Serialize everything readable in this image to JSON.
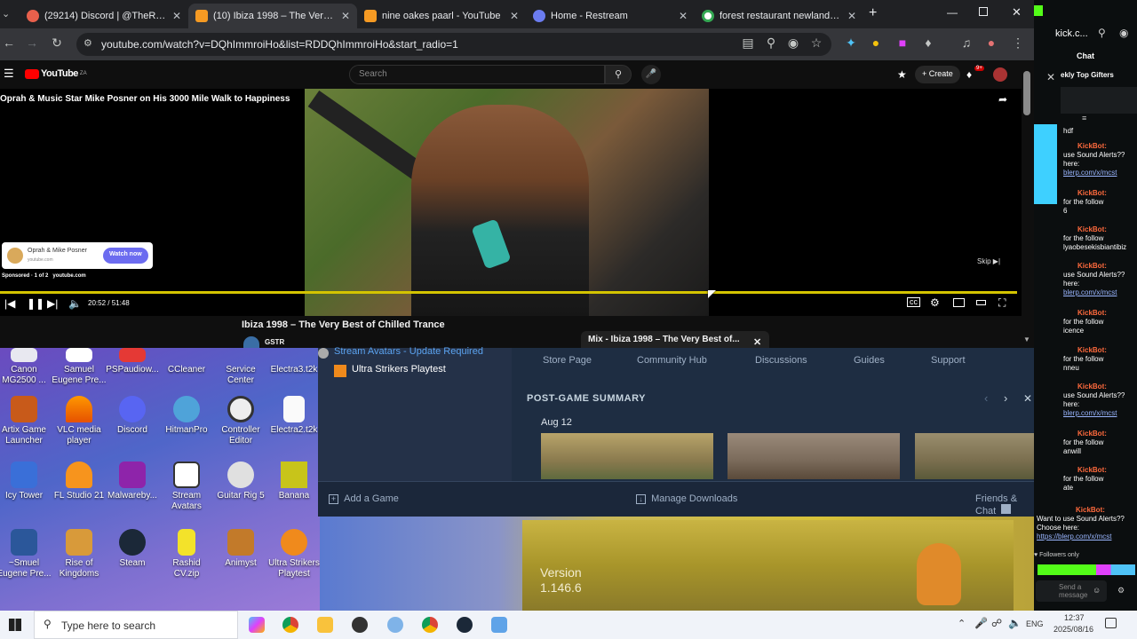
{
  "browser": {
    "tabs": [
      {
        "label": "(29214) Discord | @TheReal"
      },
      {
        "label": "(10) Ibiza 1998 – The Very B"
      },
      {
        "label": "nine oakes paarl - YouTube"
      },
      {
        "label": "Home - Restream"
      },
      {
        "label": "forest restaurant newlands - Go"
      }
    ],
    "url": "youtube.com/watch?v=DQhImmroiHo&list=RDDQhImmroiHo&start_radio=1"
  },
  "youtube": {
    "logo": "YouTube",
    "logo_sup": "ZA",
    "search_placeholder": "Search",
    "create_label": "Create",
    "notif_count": "9+",
    "ad_title": "Oprah & Music Star Mike Posner on His 3000 Mile Walk to Happiness",
    "ad_card_title": "Oprah & Mike Posner",
    "ad_card_sub": "youtube.com",
    "watch_now": "Watch now",
    "sponsored": "Sponsored · 1 of 2",
    "sponsored_site": "youtube.com",
    "skip": "Skip",
    "time": "20:52 / 51:48",
    "video_title": "Ibiza 1998 – The Very Best of Chilled Trance",
    "channel": "GSTR",
    "mix_title": "Mix - Ibiza 1998 – The Very Best of..."
  },
  "desktop": {
    "icons": [
      {
        "label": "Canon MG2500 ..."
      },
      {
        "label": "Samuel Eugene Pre..."
      },
      {
        "label": "PSPaudiow..."
      },
      {
        "label": "CCleaner"
      },
      {
        "label": "Service Center"
      },
      {
        "label": "Electra3.t2k"
      },
      {
        "label": "Artix Game Launcher"
      },
      {
        "label": "VLC media player"
      },
      {
        "label": "Discord"
      },
      {
        "label": "HitmanPro"
      },
      {
        "label": "Controller Editor"
      },
      {
        "label": "Electra2.t2k"
      },
      {
        "label": "Icy Tower"
      },
      {
        "label": "FL Studio 21"
      },
      {
        "label": "Malwareby..."
      },
      {
        "label": "Stream Avatars"
      },
      {
        "label": "Guitar Rig 5"
      },
      {
        "label": "Banana"
      },
      {
        "label": "~Smuel Eugene Pre..."
      },
      {
        "label": "Rise of Kingdoms"
      },
      {
        "label": "Steam"
      },
      {
        "label": "Rashid CV.zip"
      },
      {
        "label": "Animyst"
      },
      {
        "label": "Ultra Strikers Playtest"
      }
    ]
  },
  "steam": {
    "library_items": [
      {
        "label": "Stream Avatars - Update Required"
      },
      {
        "label": "Ultra Strikers Playtest"
      }
    ],
    "nav": [
      {
        "label": "Store Page"
      },
      {
        "label": "Community Hub"
      },
      {
        "label": "Discussions"
      },
      {
        "label": "Guides"
      },
      {
        "label": "Support"
      }
    ],
    "section_title": "POST-GAME SUMMARY",
    "date": "Aug 12",
    "add_game": "Add a Game",
    "manage_downloads": "Manage Downloads",
    "friends_chat": "Friends & Chat"
  },
  "game": {
    "version_label": "Version",
    "version_number": "1.146.6"
  },
  "kick": {
    "url": "kick.c...",
    "chat_title": "Chat",
    "gifters": "ekly Top Gifters",
    "first_line": "hdf",
    "messages": [
      {
        "user": "KickBot:",
        "text": "use Sound Alerts?? here:",
        "link": "blerp.com/x/mcst"
      },
      {
        "user": "KickBot:",
        "text": "for the follow",
        "extra": "6"
      },
      {
        "user": "KickBot:",
        "text": "for the follow",
        "extra": "lyaobesekisbiantibiz"
      },
      {
        "user": "KickBot:",
        "text": "use Sound Alerts?? here:",
        "link": "blerp.com/x/mcst"
      },
      {
        "user": "KickBot:",
        "text": "for the follow",
        "extra": "icence"
      },
      {
        "user": "KickBot:",
        "text": "for the follow",
        "extra": "nneu"
      },
      {
        "user": "KickBot:",
        "text": "use Sound Alerts?? here:",
        "link": "blerp.com/x/mcst"
      },
      {
        "user": "KickBot:",
        "text": "for the follow",
        "extra": "anwill"
      },
      {
        "user": "KickBot:",
        "text": "for the follow",
        "extra": "ate"
      }
    ],
    "last_msg": "Want to use Sound Alerts?? Choose here:",
    "last_link": "https://blerp.com/x/mcst",
    "followers_only": "Followers only",
    "send_placeholder": "Send a message"
  },
  "taskbar": {
    "search_placeholder": "Type here to search",
    "lang": "ENG",
    "time": "12:37",
    "date": "2025/08/16"
  }
}
